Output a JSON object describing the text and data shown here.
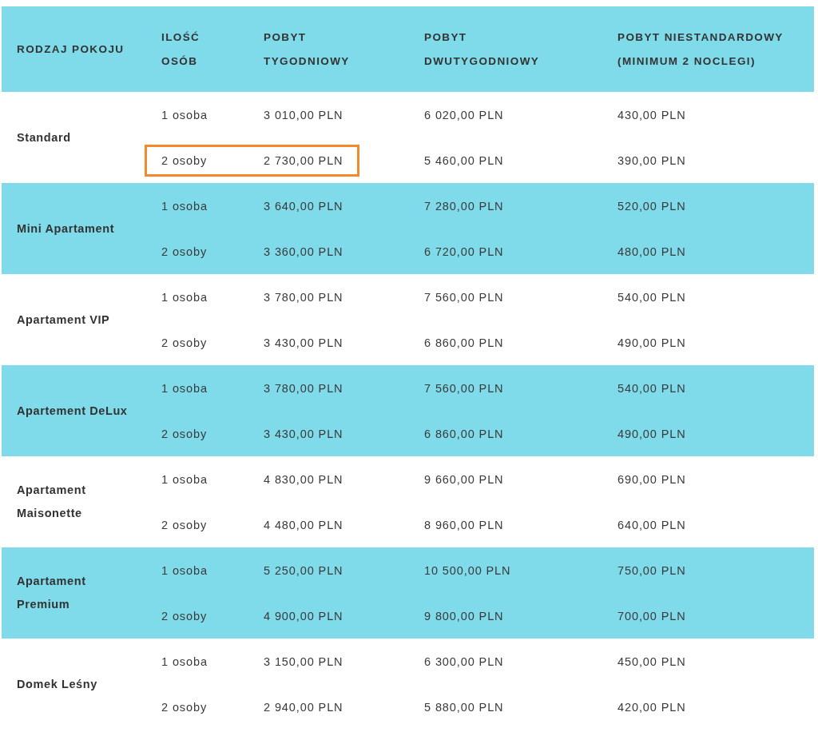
{
  "table": {
    "columns": [
      "RODZAJ POKOJU",
      "ILOŚĆ OSÓB",
      "POBYT TYGODNIOWY",
      "POBYT DWUTYGODNIOWY",
      "POBYT NIESTANDARDOWY (MINIMUM 2 NOCLEGI)"
    ],
    "groups": [
      {
        "room": "Standard",
        "rows": [
          {
            "persons": "1 osoba",
            "weekly": "3 010,00 PLN",
            "biweekly": "6 020,00 PLN",
            "custom": "430,00 PLN",
            "highlighted": false
          },
          {
            "persons": "2 osoby",
            "weekly": "2 730,00 PLN",
            "biweekly": "5 460,00 PLN",
            "custom": "390,00 PLN",
            "highlighted": true
          }
        ]
      },
      {
        "room": "Mini Apartament",
        "rows": [
          {
            "persons": "1 osoba",
            "weekly": "3 640,00 PLN",
            "biweekly": "7 280,00 PLN",
            "custom": "520,00 PLN",
            "highlighted": false
          },
          {
            "persons": "2 osoby",
            "weekly": "3 360,00 PLN",
            "biweekly": "6 720,00 PLN",
            "custom": "480,00 PLN",
            "highlighted": false
          }
        ]
      },
      {
        "room": "Apartament VIP",
        "rows": [
          {
            "persons": "1 osoba",
            "weekly": "3 780,00 PLN",
            "biweekly": "7 560,00 PLN",
            "custom": "540,00 PLN",
            "highlighted": false
          },
          {
            "persons": "2 osoby",
            "weekly": "3 430,00 PLN",
            "biweekly": "6 860,00 PLN",
            "custom": "490,00 PLN",
            "highlighted": false
          }
        ]
      },
      {
        "room": "Apartement DeLux",
        "rows": [
          {
            "persons": "1 osoba",
            "weekly": "3 780,00 PLN",
            "biweekly": "7 560,00 PLN",
            "custom": "540,00 PLN",
            "highlighted": false
          },
          {
            "persons": "2 osoby",
            "weekly": "3 430,00 PLN",
            "biweekly": "6 860,00 PLN",
            "custom": "490,00 PLN",
            "highlighted": false
          }
        ]
      },
      {
        "room": "Apartament Maisonette",
        "rows": [
          {
            "persons": "1 osoba",
            "weekly": "4 830,00 PLN",
            "biweekly": "9 660,00 PLN",
            "custom": "690,00 PLN",
            "highlighted": false
          },
          {
            "persons": "2 osoby",
            "weekly": "4 480,00 PLN",
            "biweekly": "8 960,00 PLN",
            "custom": "640,00 PLN",
            "highlighted": false
          }
        ]
      },
      {
        "room": "Apartament Premium",
        "rows": [
          {
            "persons": "1 osoba",
            "weekly": "5 250,00 PLN",
            "biweekly": "10 500,00 PLN",
            "custom": "750,00 PLN",
            "highlighted": false
          },
          {
            "persons": "2 osoby",
            "weekly": "4 900,00 PLN",
            "biweekly": "9 800,00 PLN",
            "custom": "700,00 PLN",
            "highlighted": false
          }
        ]
      },
      {
        "room": "Domek Leśny",
        "rows": [
          {
            "persons": "1 osoba",
            "weekly": "3 150,00 PLN",
            "biweekly": "6 300,00 PLN",
            "custom": "450,00 PLN",
            "highlighted": false
          },
          {
            "persons": "2 osoby",
            "weekly": "2 940,00 PLN",
            "biweekly": "5 880,00 PLN",
            "custom": "420,00 PLN",
            "highlighted": false
          }
        ]
      }
    ]
  }
}
